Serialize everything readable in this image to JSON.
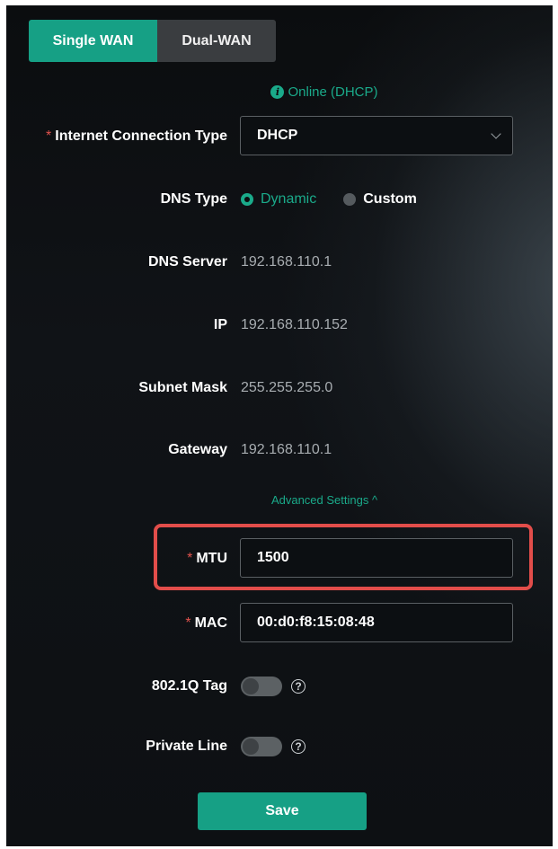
{
  "tabs": {
    "single": "Single WAN",
    "dual": "Dual-WAN"
  },
  "status": {
    "icon": "info-icon",
    "text": "Online (DHCP)"
  },
  "required_mark": "*",
  "connection_type": {
    "label": "Internet Connection Type",
    "value": "DHCP",
    "icon": "chevron-down-icon"
  },
  "dns_type": {
    "label": "DNS Type",
    "options": [
      "Dynamic",
      "Custom"
    ],
    "selected": "Dynamic"
  },
  "dns_server": {
    "label": "DNS Server",
    "value": "192.168.110.1"
  },
  "ip": {
    "label": "IP",
    "value": "192.168.110.152"
  },
  "subnet": {
    "label": "Subnet Mask",
    "value": "255.255.255.0"
  },
  "gateway": {
    "label": "Gateway",
    "value": "192.168.110.1"
  },
  "advanced": {
    "label": "Advanced Settings ^"
  },
  "mtu": {
    "label": "MTU",
    "value": "1500"
  },
  "mac": {
    "label": "MAC",
    "value": "00:d0:f8:15:08:48"
  },
  "vlan_tag": {
    "label": "802.1Q Tag",
    "enabled": false,
    "help": "?"
  },
  "private_line": {
    "label": "Private Line",
    "enabled": false,
    "help": "?"
  },
  "save_label": "Save",
  "colors": {
    "accent": "#16a085",
    "required": "#e0524d",
    "highlight": "#e24d4a"
  }
}
